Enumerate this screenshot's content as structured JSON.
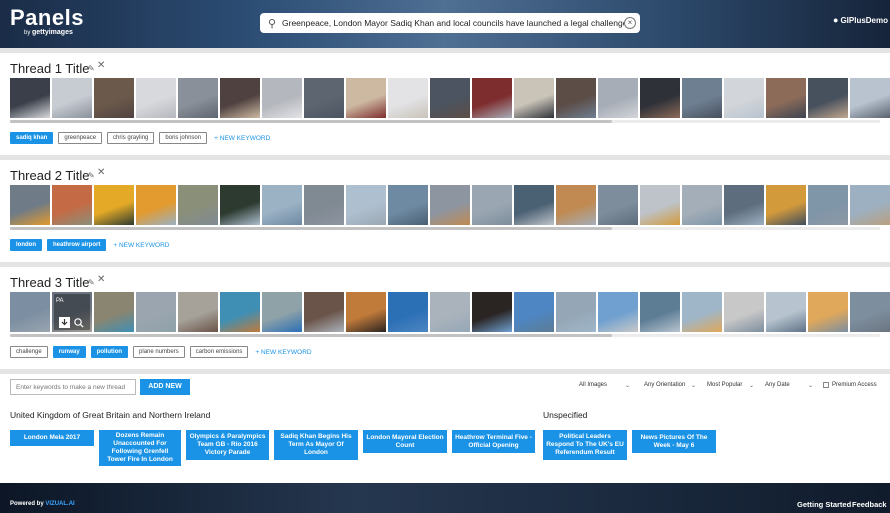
{
  "header": {
    "logo": "Panels",
    "logo_by": "by",
    "logo_brand": "gettyimages",
    "search_value": "Greenpeace, London Mayor Sadiq Khan and local councils have launched a legal challenge to block the",
    "user": "GIPlusDemo",
    "icons": [
      "search-icon",
      "clear-icon",
      "user-icon"
    ]
  },
  "threads": [
    {
      "title": "Thread 1 Title",
      "keywords": [
        {
          "label": "sadiq khan",
          "active": true
        },
        {
          "label": "greenpeace",
          "active": false
        },
        {
          "label": "chris grayling",
          "active": false
        },
        {
          "label": "boris johnson",
          "active": false
        }
      ],
      "new_keyword": "+ NEW KEYWORD",
      "palette": [
        "#3a3f4a",
        "#c7ccd3",
        "#6b5a4b",
        "#d7d9dc",
        "#8a9099",
        "#4f4140",
        "#b4b7bd",
        "#5d6571",
        "#cdb9a2",
        "#e3e3e6",
        "#4b5460",
        "#7e2d2e",
        "#c9c3b8",
        "#5c4d47",
        "#a7adb7",
        "#2e3138",
        "#6e7f92",
        "#d2d5d9",
        "#8c6b59",
        "#47505d",
        "#b8c3cf",
        "#3d4451",
        "#c1a78f",
        "#5a6270",
        "#a9b5c1",
        "#3f3630",
        "#7a8594",
        "#d0cfcb",
        "#5e5a57",
        "#1f2a44",
        "#9aa2ac",
        "#4a3f3a",
        "#c4ccd6",
        "#6c7381"
      ]
    },
    {
      "title": "Thread 2 Title",
      "keywords": [
        {
          "label": "london",
          "active": true
        },
        {
          "label": "heathrow airport",
          "active": true
        }
      ],
      "new_keyword": "+ NEW KEYWORD",
      "palette": [
        "#6f7b86",
        "#c46b45",
        "#e3a927",
        "#e39a2e",
        "#8a8f7a",
        "#2c3a2f",
        "#9bb1c4",
        "#808a93",
        "#aebfcf",
        "#6e8aa3",
        "#8d95a0",
        "#9aa7b3",
        "#4a6073",
        "#c08a52",
        "#7d8d9b",
        "#bdc3c9",
        "#a4aeb8",
        "#5d6d7d",
        "#d39a3c",
        "#7f95a8",
        "#9db0c1",
        "#3e4e5d",
        "#8e99a5",
        "#b9a080",
        "#6c7d8f",
        "#a8b4bf"
      ]
    },
    {
      "title": "Thread 3 Title",
      "keywords": [
        {
          "label": "challenge",
          "active": false
        },
        {
          "label": "runway",
          "active": true
        },
        {
          "label": "pollution",
          "active": true
        },
        {
          "label": "plane numbers",
          "active": false
        },
        {
          "label": "carbon emissions",
          "active": false
        }
      ],
      "new_keyword": "+ NEW KEYWORD",
      "palette": [
        "#7c8fa2",
        "#6b7480",
        "#8a8570",
        "#9aa5b0",
        "#a6a29a",
        "#3f8fb5",
        "#8fa2a8",
        "#6a5348",
        "#c07a3a",
        "#2b6fb5",
        "#aab3bb",
        "#2a2422",
        "#4d86c2",
        "#95a7b7",
        "#6fa0d0",
        "#5d7d95",
        "#9fb6c8",
        "#c8c8c8",
        "#b7c4cf",
        "#e0a85a",
        "#7d8e9e",
        "#5f7287"
      ]
    }
  ],
  "controls": {
    "keyword_placeholder": "Enter keywords to make a new thread",
    "add_button": "ADD NEW",
    "filters": [
      "All Images",
      "Any Orientation",
      "Most Popular",
      "Any Date"
    ],
    "premium_label": "Premium Access"
  },
  "suggestions": [
    {
      "group": "United Kingdom of Great Britain and Northern Ireland",
      "items": [
        "London Mela 2017",
        "Dozens Remain Unaccounted For Following Grenfell Tower Fire In London",
        "Olympics & Paralympics Team GB - Rio 2016 Victory Parade",
        "Sadiq Khan Begins His Term As Mayor Of London",
        "London Mayoral Election Count",
        "Heathrow Terminal Five - Official Opening"
      ]
    },
    {
      "group": "Unspecified",
      "items": [
        "Political Leaders Respond To The UK's EU Referendum Result",
        "News Pictures Of The Week - May 6"
      ]
    }
  ],
  "footer": {
    "powered_by": "Powered by",
    "brand": "VIZUAL.AI",
    "links": [
      "Getting Started",
      "Feedback"
    ]
  },
  "colors": {
    "accent": "#1a93e6",
    "header_dark": "#1a2c47"
  }
}
